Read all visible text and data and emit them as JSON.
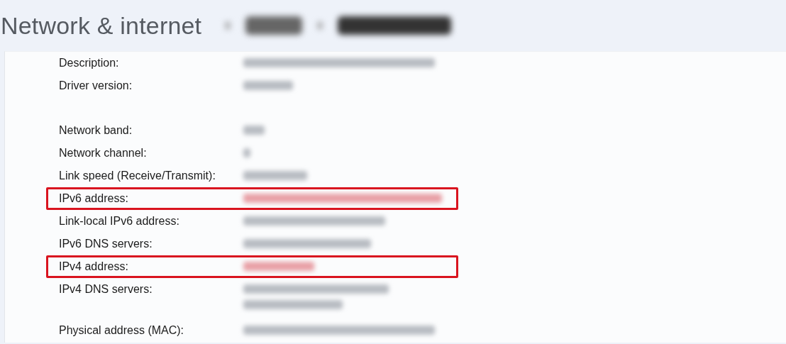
{
  "header": {
    "title": "Network & internet",
    "breadcrumb_redacted": true
  },
  "properties": [
    {
      "kind": "row",
      "label": "Description:",
      "values": [
        {
          "redacted": true
        }
      ],
      "highlighted": false
    },
    {
      "kind": "row",
      "label": "Driver version:",
      "values": [
        {
          "redacted": true
        }
      ],
      "highlighted": false
    },
    {
      "kind": "gap"
    },
    {
      "kind": "row",
      "label": "Network band:",
      "values": [
        {
          "redacted": true
        }
      ],
      "highlighted": false
    },
    {
      "kind": "row",
      "label": "Network channel:",
      "values": [
        {
          "redacted": true
        }
      ],
      "highlighted": false
    },
    {
      "kind": "row",
      "label": "Link speed (Receive/Transmit):",
      "values": [
        {
          "redacted": true
        }
      ],
      "highlighted": false
    },
    {
      "kind": "row",
      "label": "IPv6 address:",
      "values": [
        {
          "redacted": true
        }
      ],
      "highlighted": true
    },
    {
      "kind": "row",
      "label": "Link-local IPv6 address:",
      "values": [
        {
          "redacted": true
        }
      ],
      "highlighted": false
    },
    {
      "kind": "row",
      "label": "IPv6 DNS servers:",
      "values": [
        {
          "redacted": true
        }
      ],
      "highlighted": false
    },
    {
      "kind": "row",
      "label": "IPv4 address:",
      "values": [
        {
          "redacted": true
        }
      ],
      "highlighted": true
    },
    {
      "kind": "row",
      "label": "IPv4 DNS servers:",
      "values": [
        {
          "redacted": true
        },
        {
          "redacted": true
        }
      ],
      "highlighted": false
    },
    {
      "kind": "row",
      "label": "Physical address (MAC):",
      "values": [
        {
          "redacted": true
        }
      ],
      "highlighted": false
    }
  ]
}
